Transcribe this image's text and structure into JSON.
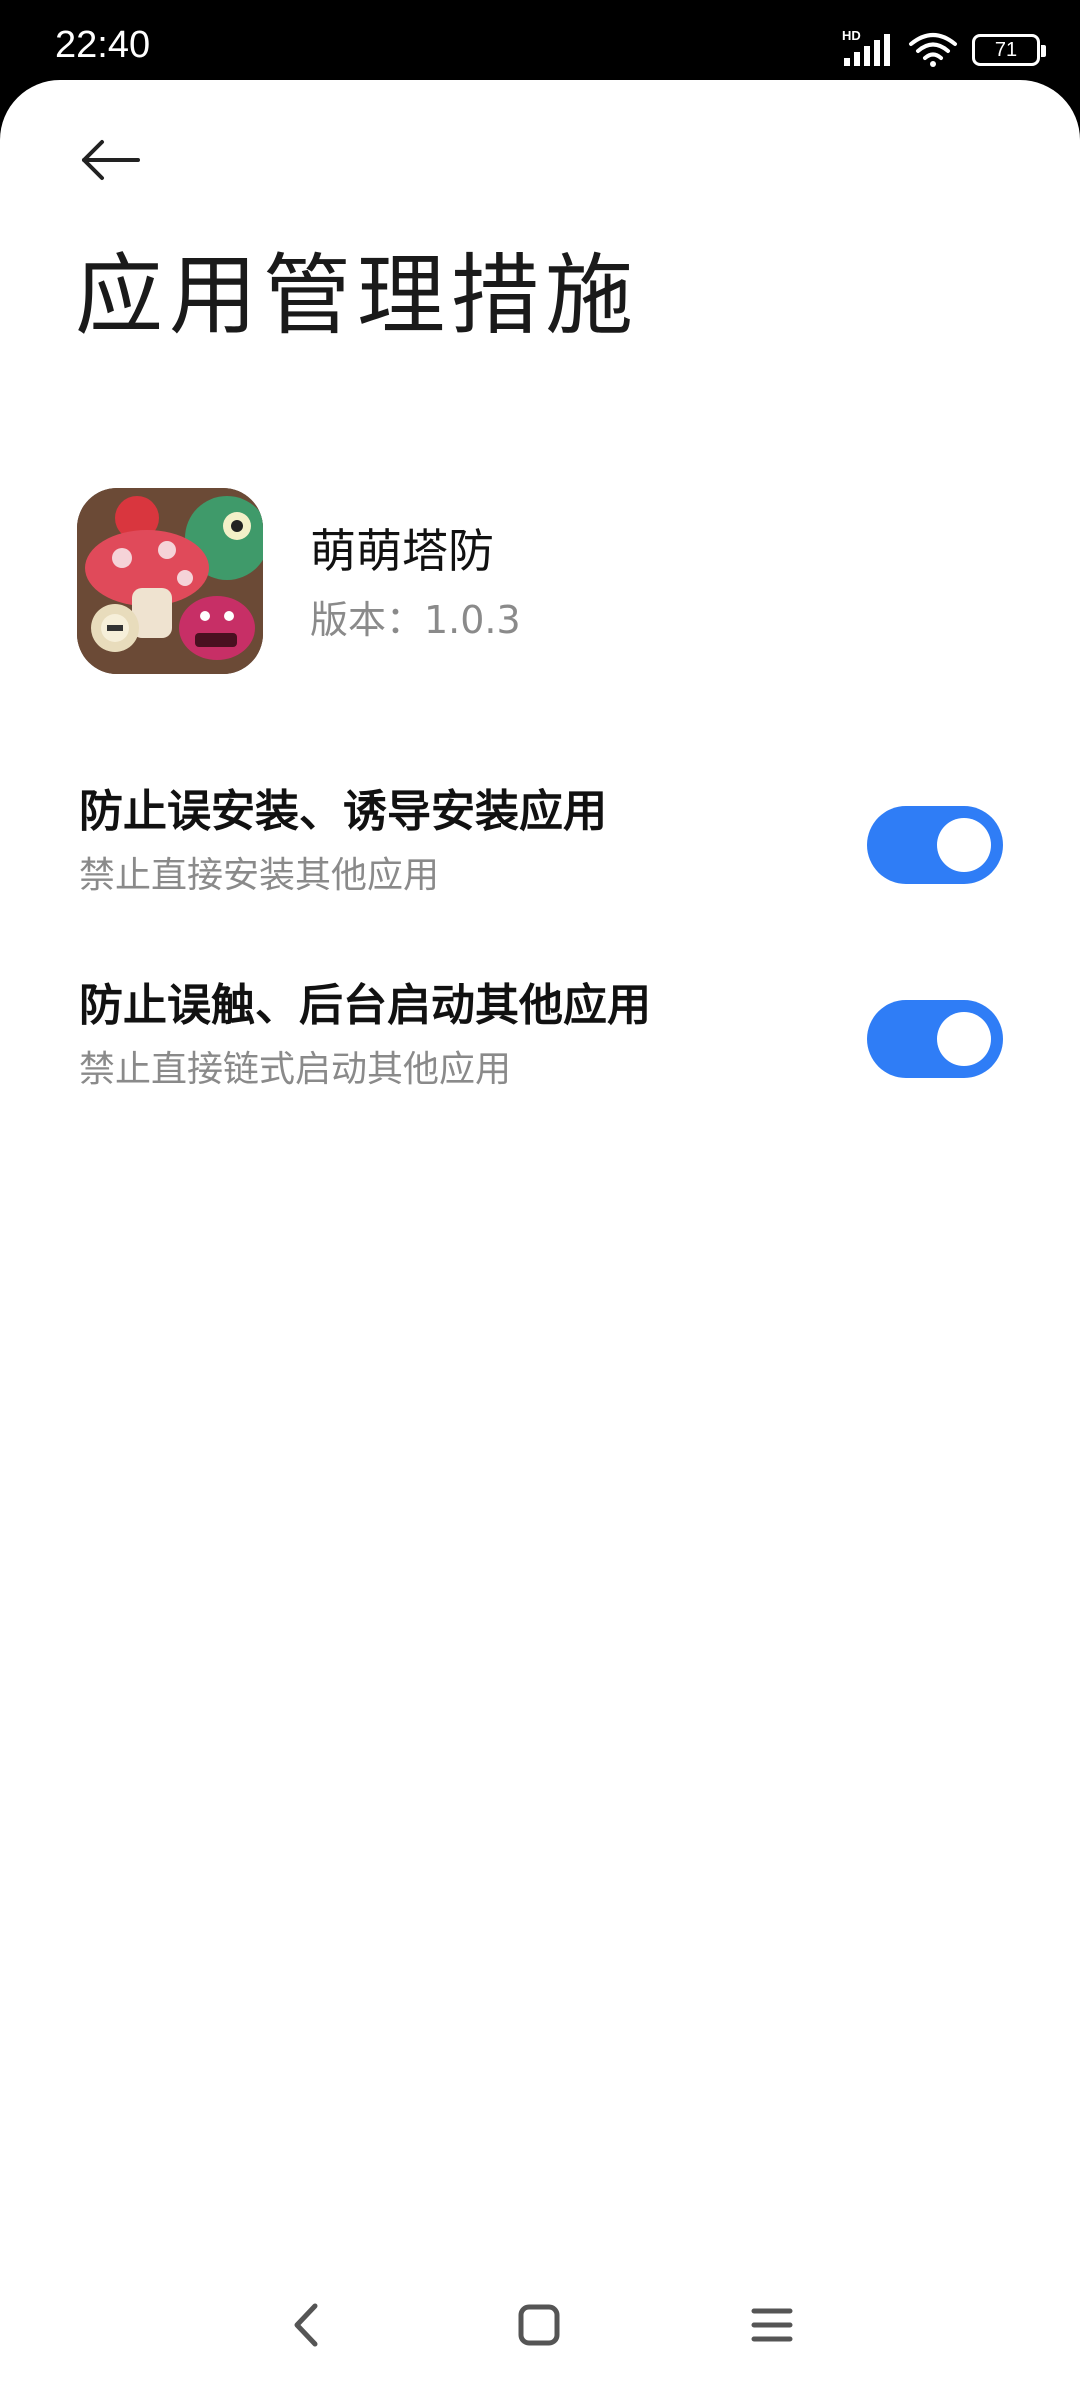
{
  "status_bar": {
    "time": "22:40",
    "network_badge": "HD",
    "battery_level": "71",
    "icons": [
      "signal-icon",
      "wifi-icon",
      "battery-icon"
    ]
  },
  "header": {
    "back_icon": "back-arrow-icon",
    "title": "应用管理措施"
  },
  "app": {
    "name": "萌萌塔防",
    "version": "版本：1.0.3",
    "icon": "app-icon"
  },
  "settings": [
    {
      "title": "防止误安装、诱导安装应用",
      "subtitle": "禁止直接安装其他应用",
      "enabled": true
    },
    {
      "title": "防止误触、后台启动其他应用",
      "subtitle": "禁止直接链式启动其他应用",
      "enabled": true
    }
  ],
  "nav": {
    "icons": [
      "nav-back-icon",
      "nav-home-icon",
      "nav-recents-icon"
    ]
  },
  "colors": {
    "accent": "#2f7df6",
    "background": "#ffffff",
    "status_bar": "#000000"
  }
}
